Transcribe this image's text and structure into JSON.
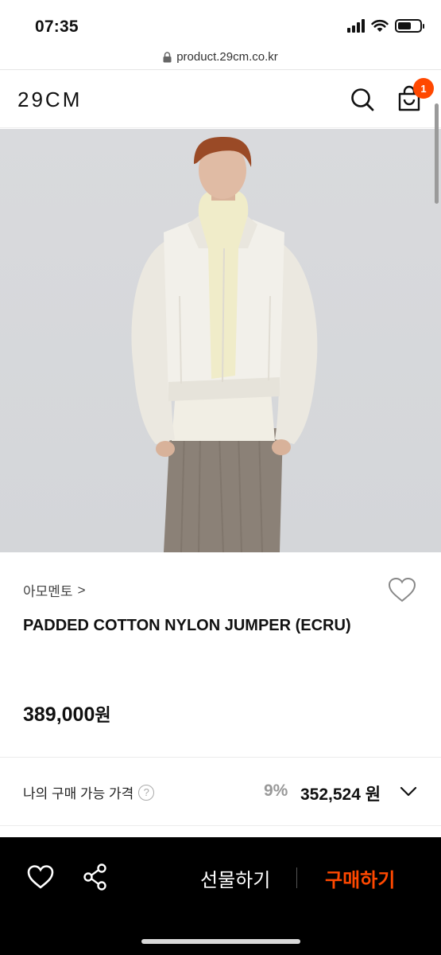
{
  "status_bar": {
    "time": "07:35",
    "battery_level": 0.6
  },
  "browser": {
    "url": "product.29cm.co.kr",
    "lock_icon": "lock-icon"
  },
  "header": {
    "logo": "29CM",
    "search_icon": "search-icon",
    "cart_icon": "shopping-bag-icon",
    "cart_count": "1"
  },
  "product": {
    "image_alt_icon": "product-photo",
    "brand": "아모멘토",
    "brand_chevron": ">",
    "name": "PADDED COTTON NYLON JUMPER (ECRU)",
    "price_number": "389,000",
    "price_unit": "원"
  },
  "my_price": {
    "label": "나의 구매 가능 가격",
    "help": "?",
    "discount": "9%",
    "price": "352,524 원"
  },
  "bottom_bar": {
    "gift_label": "선물하기",
    "buy_label": "구매하기"
  },
  "colors": {
    "accent": "#ff4800",
    "bottom_bar_bg": "#000000"
  }
}
